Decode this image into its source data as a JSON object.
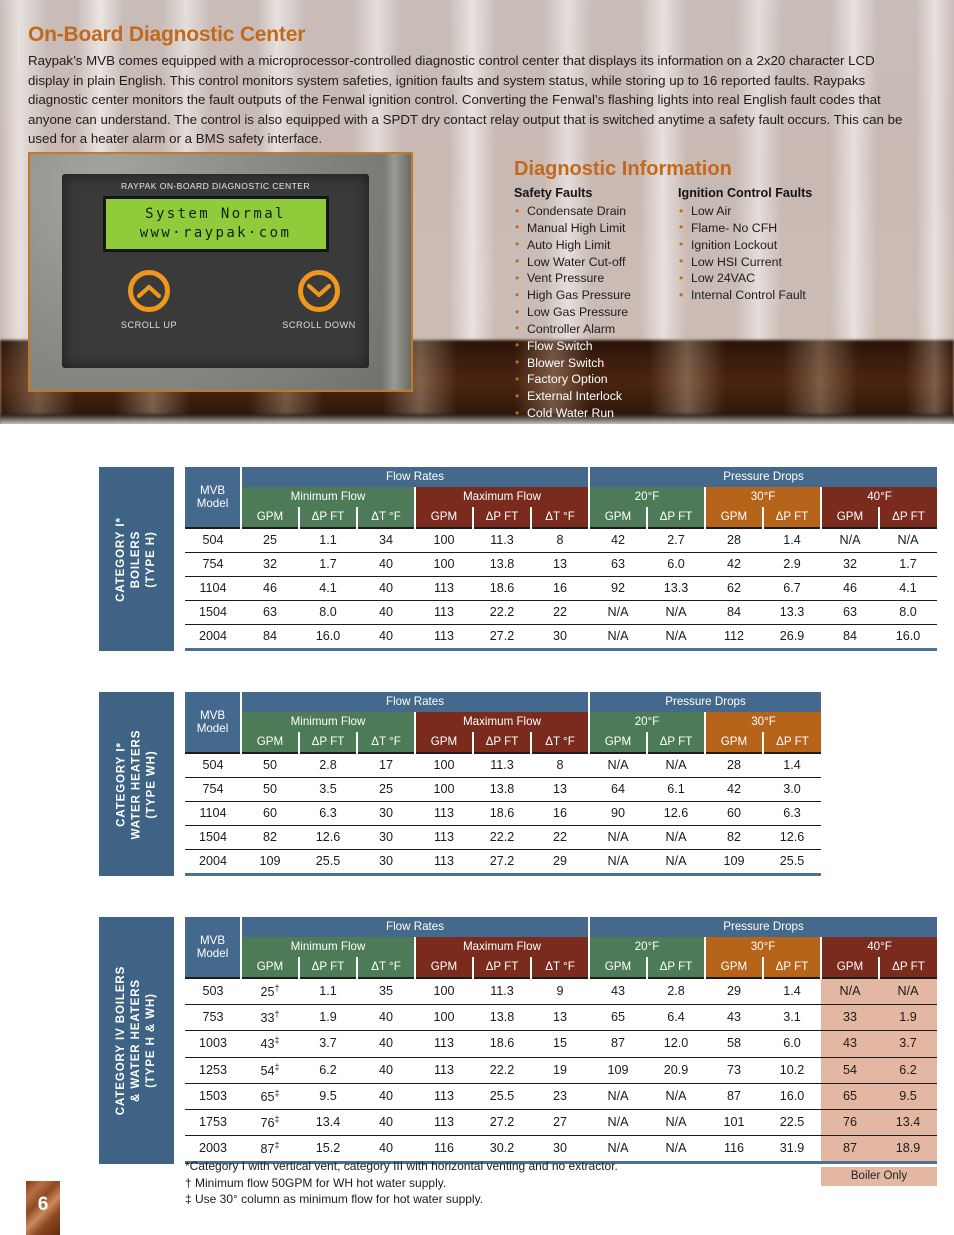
{
  "header": {
    "title": "On-Board Diagnostic Center",
    "intro": "Raypak’s MVB comes equipped with a microprocessor-controlled diagnostic control center that displays its information on a 2x20 character LCD display in plain English.  This control monitors system safeties, ignition faults and system status, while storing up to 16 reported faults. Raypaks diagnostic center monitors the fault outputs of the Fenwal ignition control.  Converting the Fenwal’s flashing lights into real English fault codes that anyone can understand.  The control is also equipped with a SPDT dry contact relay output that is switched anytime a safety fault occurs. This can be used for a heater alarm or a BMS safety interface."
  },
  "device": {
    "panel_label": "RAYPAK ON-BOARD DIAGNOSTIC CENTER",
    "lcd_line1": "System Normal",
    "lcd_line2": "www·raypak·com",
    "button_up_label": "SCROLL UP",
    "button_down_label": "SCROLL DOWN"
  },
  "diagnostic": {
    "title": "Diagnostic Information",
    "safety_heading": "Safety Faults",
    "safety_faults": [
      "Condensate Drain",
      "Manual High Limit",
      "Auto High Limit",
      "Low Water Cut-off",
      "Vent Pressure",
      "High Gas Pressure",
      "Low Gas Pressure",
      "Controller Alarm",
      "Flow Switch",
      "Blower Switch",
      "Factory Option",
      "External Interlock",
      "Cold Water Run"
    ],
    "ignition_heading": "Ignition Control Faults",
    "ignition_faults": [
      "Low Air",
      "Flame- No CFH",
      "Ignition Lockout",
      "Low HSI Current",
      "Low 24VAC",
      "Internal Control Fault"
    ]
  },
  "colors": {
    "accent_orange": "#c2691c",
    "header_blue": "#44698c",
    "header_green": "#4d7a57",
    "header_darkred": "#7a2b1d",
    "header_orange": "#b5641a",
    "highlight_salmon": "#e4b7a2",
    "lcd_green": "#8fcb3b",
    "button_orange": "#f0981e"
  },
  "tables": [
    {
      "side_label": "CATEGORY I*\nBOILERS\n(TYPE H)",
      "group_headers": [
        "MVB\nModel",
        "Flow Rates",
        "Pressure Drops"
      ],
      "sub_headers": [
        "Minimum Flow",
        "Maximum Flow",
        "20°F",
        "30°F",
        "40°F"
      ],
      "col_headers": [
        "GPM",
        "ΔP FT",
        "ΔT °F",
        "GPM",
        "ΔP FT",
        "ΔT °F",
        "GPM",
        "ΔP FT",
        "GPM",
        "ΔP FT",
        "GPM",
        "ΔP FT"
      ],
      "rows": [
        [
          "504",
          "25",
          "1.1",
          "34",
          "100",
          "11.3",
          "8",
          "42",
          "2.7",
          "28",
          "1.4",
          "N/A",
          "N/A"
        ],
        [
          "754",
          "32",
          "1.7",
          "40",
          "100",
          "13.8",
          "13",
          "63",
          "6.0",
          "42",
          "2.9",
          "32",
          "1.7"
        ],
        [
          "1104",
          "46",
          "4.1",
          "40",
          "113",
          "18.6",
          "16",
          "92",
          "13.3",
          "62",
          "6.7",
          "46",
          "4.1"
        ],
        [
          "1504",
          "63",
          "8.0",
          "40",
          "113",
          "22.2",
          "22",
          "N/A",
          "N/A",
          "84",
          "13.3",
          "63",
          "8.0"
        ],
        [
          "2004",
          "84",
          "16.0",
          "40",
          "113",
          "27.2",
          "30",
          "N/A",
          "N/A",
          "112",
          "26.9",
          "84",
          "16.0"
        ]
      ]
    },
    {
      "side_label": "CATEGORY I*\nWATER HEATERS\n(TYPE WH)",
      "group_headers": [
        "MVB\nModel",
        "Flow Rates",
        "Pressure Drops"
      ],
      "sub_headers": [
        "Minimum Flow",
        "Maximum Flow",
        "20°F",
        "30°F"
      ],
      "col_headers": [
        "GPM",
        "ΔP FT",
        "ΔT °F",
        "GPM",
        "ΔP FT",
        "ΔT °F",
        "GPM",
        "ΔP FT",
        "GPM",
        "ΔP FT"
      ],
      "rows": [
        [
          "504",
          "50",
          "2.8",
          "17",
          "100",
          "11.3",
          "8",
          "N/A",
          "N/A",
          "28",
          "1.4"
        ],
        [
          "754",
          "50",
          "3.5",
          "25",
          "100",
          "13.8",
          "13",
          "64",
          "6.1",
          "42",
          "3.0"
        ],
        [
          "1104",
          "60",
          "6.3",
          "30",
          "113",
          "18.6",
          "16",
          "90",
          "12.6",
          "60",
          "6.3"
        ],
        [
          "1504",
          "82",
          "12.6",
          "30",
          "113",
          "22.2",
          "22",
          "N/A",
          "N/A",
          "82",
          "12.6"
        ],
        [
          "2004",
          "109",
          "25.5",
          "30",
          "113",
          "27.2",
          "29",
          "N/A",
          "N/A",
          "109",
          "25.5"
        ]
      ]
    },
    {
      "side_label": "CATEGORY IV BOILERS\n& WATER HEATERS\n(TYPE H & WH)",
      "group_headers": [
        "MVB\nModel",
        "Flow Rates",
        "Pressure Drops"
      ],
      "sub_headers": [
        "Minimum Flow",
        "Maximum Flow",
        "20°F",
        "30°F",
        "40°F"
      ],
      "col_headers": [
        "GPM",
        "ΔP FT",
        "ΔT °F",
        "GPM",
        "ΔP FT",
        "ΔT °F",
        "GPM",
        "ΔP FT",
        "GPM",
        "ΔP FT",
        "GPM",
        "ΔP FT"
      ],
      "highlight_cols": [
        11,
        12
      ],
      "footer_note": "Boiler Only",
      "rows": [
        [
          "503",
          "25†",
          "1.1",
          "35",
          "100",
          "11.3",
          "9",
          "43",
          "2.8",
          "29",
          "1.4",
          "N/A",
          "N/A"
        ],
        [
          "753",
          "33†",
          "1.9",
          "40",
          "100",
          "13.8",
          "13",
          "65",
          "6.4",
          "43",
          "3.1",
          "33",
          "1.9"
        ],
        [
          "1003",
          "43‡",
          "3.7",
          "40",
          "113",
          "18.6",
          "15",
          "87",
          "12.0",
          "58",
          "6.0",
          "43",
          "3.7"
        ],
        [
          "1253",
          "54‡",
          "6.2",
          "40",
          "113",
          "22.2",
          "19",
          "109",
          "20.9",
          "73",
          "10.2",
          "54",
          "6.2"
        ],
        [
          "1503",
          "65‡",
          "9.5",
          "40",
          "113",
          "25.5",
          "23",
          "N/A",
          "N/A",
          "87",
          "16.0",
          "65",
          "9.5"
        ],
        [
          "1753",
          "76‡",
          "13.4",
          "40",
          "113",
          "27.2",
          "27",
          "N/A",
          "N/A",
          "101",
          "22.5",
          "76",
          "13.4"
        ],
        [
          "2003",
          "87‡",
          "15.2",
          "40",
          "116",
          "30.2",
          "30",
          "N/A",
          "N/A",
          "116",
          "31.9",
          "87",
          "18.9"
        ]
      ]
    }
  ],
  "footnotes": [
    "*Category I with vertical vent, category III with horizontal venting and no extractor.",
    "† Minimum flow 50GPM for WH hot water supply.",
    "‡ Use 30° column as minimum flow for hot water supply."
  ],
  "page_number": "6"
}
